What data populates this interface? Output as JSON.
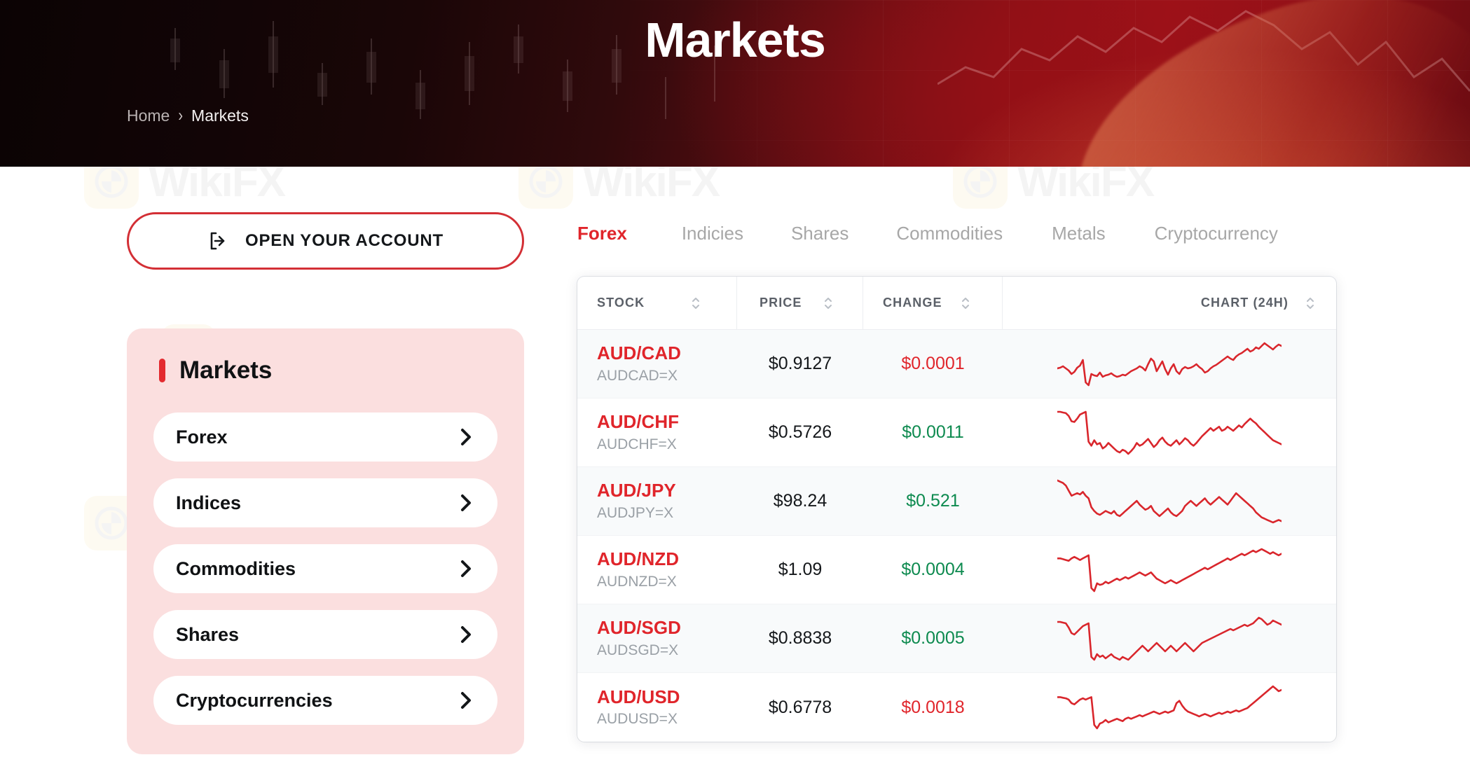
{
  "hero": {
    "title": "Markets",
    "breadcrumb": {
      "home": "Home",
      "separator": "›",
      "current": "Markets"
    }
  },
  "sidebar": {
    "cta": {
      "label": "OPEN YOUR ACCOUNT",
      "icon": "logout-arrow-icon"
    },
    "panel_title": "Markets",
    "items": [
      {
        "label": "Forex"
      },
      {
        "label": "Indices"
      },
      {
        "label": "Commodities"
      },
      {
        "label": "Shares"
      },
      {
        "label": "Cryptocurrencies"
      }
    ]
  },
  "main": {
    "tabs": [
      {
        "label": "Forex",
        "active": true
      },
      {
        "label": "Indicies",
        "active": false
      },
      {
        "label": "Shares",
        "active": false
      },
      {
        "label": "Commodities",
        "active": false
      },
      {
        "label": "Metals",
        "active": false
      },
      {
        "label": "Cryptocurrency",
        "active": false
      }
    ],
    "table": {
      "columns": [
        "STOCK",
        "PRICE",
        "CHANGE",
        "CHART (24H)"
      ],
      "rows": [
        {
          "pair": "AUD/CAD",
          "symbol": "AUDCAD=X",
          "price": "$0.9127",
          "change": "$0.0001",
          "direction": "down"
        },
        {
          "pair": "AUD/CHF",
          "symbol": "AUDCHF=X",
          "price": "$0.5726",
          "change": "$0.0011",
          "direction": "up"
        },
        {
          "pair": "AUD/JPY",
          "symbol": "AUDJPY=X",
          "price": "$98.24",
          "change": "$0.521",
          "direction": "up"
        },
        {
          "pair": "AUD/NZD",
          "symbol": "AUDNZD=X",
          "price": "$1.09",
          "change": "$0.0004",
          "direction": "up"
        },
        {
          "pair": "AUD/SGD",
          "symbol": "AUDSGD=X",
          "price": "$0.8838",
          "change": "$0.0005",
          "direction": "up"
        },
        {
          "pair": "AUD/USD",
          "symbol": "AUDUSD=X",
          "price": "$0.6778",
          "change": "$0.0018",
          "direction": "down"
        }
      ]
    }
  },
  "watermark": {
    "text": "WikiFX"
  },
  "colors": {
    "brand_red": "#e0252b",
    "cta_border": "#d32f35",
    "panel_bg": "#fbdfdf",
    "up_green": "#0d8a4f",
    "down_red": "#e0252b",
    "sparkline": "#d9262c"
  },
  "chart_data": [
    {
      "type": "line",
      "title": "AUD/CAD 24H",
      "series": [
        {
          "name": "AUD/CAD",
          "values": [
            30,
            31,
            33,
            30,
            27,
            22,
            25,
            31,
            34,
            42,
            10,
            6,
            22,
            20,
            19,
            24,
            18,
            20,
            21,
            23,
            20,
            18,
            19,
            21,
            20,
            23,
            26,
            28,
            30,
            33,
            31,
            27,
            36,
            44,
            40,
            26,
            33,
            40,
            29,
            21,
            30,
            36,
            26,
            22,
            29,
            32,
            30,
            31,
            33,
            36,
            32,
            29,
            24,
            26,
            30,
            33,
            35,
            38,
            41,
            44,
            47,
            44,
            42,
            47,
            50,
            52,
            55,
            58,
            54,
            56,
            60,
            58,
            62,
            66,
            63,
            60,
            57,
            61,
            64,
            62
          ]
        }
      ]
    },
    {
      "type": "line",
      "title": "AUD/CHF 24H",
      "series": [
        {
          "name": "AUD/CHF",
          "values": [
            72,
            72,
            71,
            70,
            66,
            58,
            57,
            62,
            68,
            70,
            72,
            28,
            22,
            30,
            24,
            26,
            18,
            21,
            26,
            22,
            18,
            14,
            12,
            16,
            14,
            10,
            14,
            19,
            26,
            22,
            24,
            28,
            32,
            26,
            20,
            24,
            30,
            34,
            28,
            24,
            22,
            26,
            30,
            24,
            28,
            33,
            30,
            25,
            22,
            26,
            31,
            36,
            40,
            44,
            48,
            44,
            47,
            50,
            44,
            46,
            50,
            47,
            44,
            48,
            52,
            49,
            54,
            58,
            62,
            58,
            55,
            50,
            46,
            42,
            38,
            34,
            30,
            28,
            26,
            24
          ]
        }
      ]
    },
    {
      "type": "line",
      "title": "AUD/JPY 24H",
      "series": [
        {
          "name": "AUD/JPY",
          "values": [
            78,
            76,
            74,
            70,
            62,
            54,
            56,
            58,
            56,
            60,
            54,
            50,
            36,
            30,
            26,
            24,
            27,
            30,
            28,
            26,
            30,
            24,
            22,
            26,
            30,
            34,
            38,
            42,
            46,
            40,
            36,
            32,
            34,
            38,
            30,
            26,
            22,
            26,
            30,
            34,
            28,
            24,
            22,
            26,
            30,
            38,
            42,
            46,
            42,
            38,
            42,
            46,
            50,
            44,
            40,
            44,
            48,
            52,
            48,
            44,
            40,
            46,
            52,
            58,
            54,
            50,
            46,
            42,
            38,
            34,
            28,
            24,
            20,
            18,
            16,
            14,
            12,
            14,
            16,
            14
          ]
        }
      ]
    },
    {
      "type": "line",
      "title": "AUD/NZD 24H",
      "series": [
        {
          "name": "AUD/NZD",
          "values": [
            52,
            52,
            51,
            50,
            49,
            52,
            54,
            52,
            50,
            52,
            54,
            56,
            14,
            10,
            20,
            18,
            19,
            22,
            20,
            22,
            24,
            26,
            24,
            26,
            28,
            26,
            28,
            30,
            32,
            34,
            32,
            30,
            32,
            34,
            30,
            26,
            24,
            22,
            20,
            22,
            24,
            22,
            20,
            22,
            24,
            26,
            28,
            30,
            32,
            34,
            36,
            38,
            40,
            38,
            40,
            42,
            44,
            46,
            48,
            50,
            52,
            50,
            52,
            54,
            56,
            58,
            56,
            58,
            60,
            62,
            60,
            62,
            64,
            62,
            60,
            58,
            60,
            58,
            56,
            58
          ]
        }
      ]
    },
    {
      "type": "line",
      "title": "AUD/SGD 24H",
      "series": [
        {
          "name": "AUD/SGD",
          "values": [
            68,
            68,
            67,
            66,
            60,
            52,
            50,
            54,
            58,
            62,
            64,
            66,
            18,
            14,
            22,
            18,
            20,
            16,
            19,
            22,
            18,
            16,
            14,
            18,
            16,
            14,
            18,
            22,
            26,
            30,
            34,
            30,
            26,
            30,
            34,
            38,
            34,
            30,
            26,
            30,
            34,
            30,
            26,
            30,
            34,
            38,
            34,
            30,
            26,
            30,
            34,
            38,
            40,
            42,
            44,
            46,
            48,
            50,
            52,
            54,
            56,
            58,
            56,
            58,
            60,
            62,
            64,
            62,
            64,
            66,
            70,
            74,
            72,
            68,
            64,
            66,
            70,
            68,
            66,
            64
          ]
        }
      ]
    },
    {
      "type": "line",
      "title": "AUD/USD 24H",
      "series": [
        {
          "name": "AUD/USD",
          "values": [
            60,
            60,
            59,
            58,
            56,
            50,
            48,
            52,
            56,
            58,
            56,
            58,
            60,
            14,
            8,
            16,
            18,
            22,
            18,
            20,
            22,
            24,
            22,
            20,
            24,
            26,
            24,
            26,
            28,
            30,
            28,
            30,
            32,
            34,
            36,
            34,
            32,
            34,
            36,
            34,
            36,
            38,
            50,
            54,
            46,
            40,
            36,
            34,
            32,
            30,
            28,
            30,
            32,
            30,
            28,
            30,
            32,
            34,
            32,
            34,
            36,
            34,
            36,
            38,
            36,
            38,
            40,
            42,
            46,
            50,
            54,
            58,
            62,
            66,
            70,
            74,
            78,
            74,
            70,
            72
          ]
        }
      ]
    }
  ]
}
